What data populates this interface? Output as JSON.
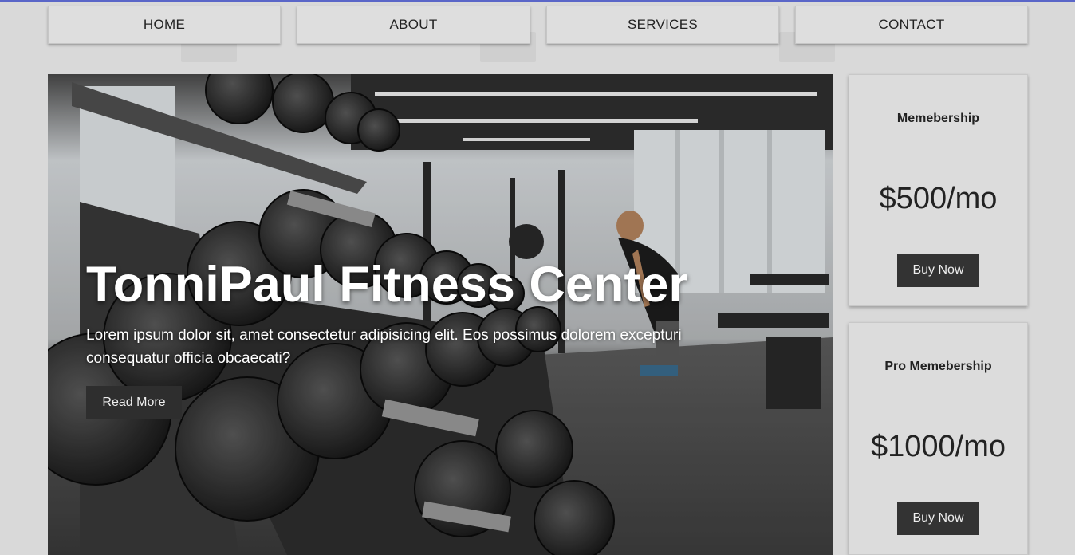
{
  "nav": {
    "items": [
      "HOME",
      "ABOUT",
      "SERVICES",
      "CONTACT"
    ]
  },
  "hero": {
    "title": "TonniPaul Fitness Center",
    "text": "Lorem ipsum dolor sit, amet consectetur adipisicing elit. Eos possimus dolorem excepturi consequatur officia obcaecati?",
    "button_label": "Read More",
    "image": "gym-dumbbell-rack-photo"
  },
  "plans": [
    {
      "title": "Memebership",
      "price": "$500/mo",
      "button_label": "Buy Now"
    },
    {
      "title": "Pro Memebership",
      "price": "$1000/mo",
      "button_label": "Buy Now"
    }
  ],
  "colors": {
    "page_background": "#d9d9d9",
    "card_background": "#dcdcdc",
    "button_dark": "#2e2e2e",
    "top_accent": "#5a66c8"
  }
}
